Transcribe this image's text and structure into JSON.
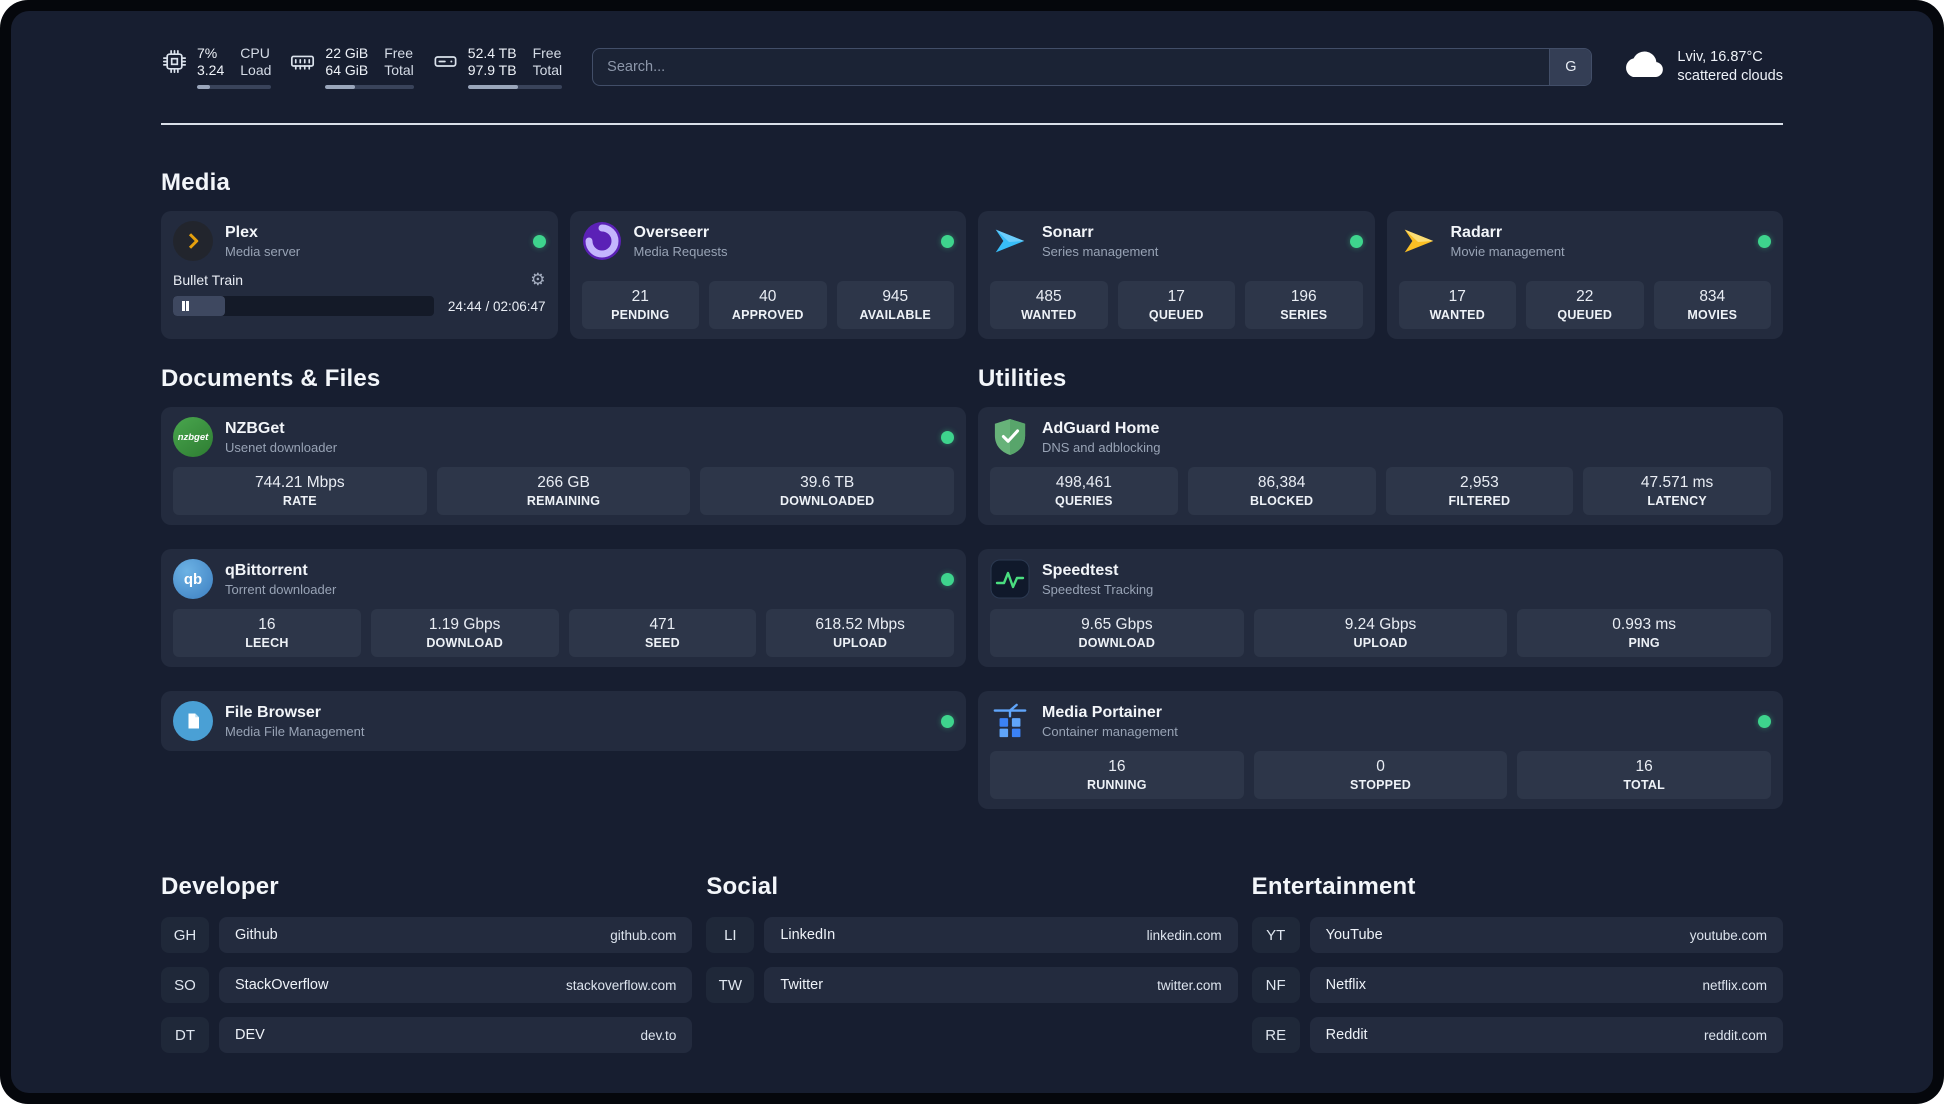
{
  "topbar": {
    "cpu": {
      "value_top": "7%",
      "value_bottom": "3.24",
      "label_top": "CPU",
      "label_bottom": "Load",
      "meter_percent": 18
    },
    "ram": {
      "value_top": "22 GiB",
      "value_bottom": "64 GiB",
      "label_top": "Free",
      "label_bottom": "Total",
      "meter_percent": 33
    },
    "disk": {
      "value_top": "52.4 TB",
      "value_bottom": "97.9 TB",
      "label_top": "Free",
      "label_bottom": "Total",
      "meter_percent": 53
    },
    "search": {
      "placeholder": "Search...",
      "provider_label": "G"
    },
    "weather": {
      "location": "Lviv, 16.87°C",
      "condition": "scattered clouds"
    }
  },
  "media": {
    "title": "Media",
    "plex": {
      "name": "Plex",
      "desc": "Media server",
      "now_playing": "Bullet Train",
      "time": "24:44 / 02:06:47",
      "progress_percent": 20
    },
    "overseerr": {
      "name": "Overseerr",
      "desc": "Media Requests",
      "stats": [
        {
          "value": "21",
          "label": "PENDING"
        },
        {
          "value": "40",
          "label": "APPROVED"
        },
        {
          "value": "945",
          "label": "AVAILABLE"
        }
      ]
    },
    "sonarr": {
      "name": "Sonarr",
      "desc": "Series management",
      "stats": [
        {
          "value": "485",
          "label": "WANTED"
        },
        {
          "value": "17",
          "label": "QUEUED"
        },
        {
          "value": "196",
          "label": "SERIES"
        }
      ]
    },
    "radarr": {
      "name": "Radarr",
      "desc": "Movie management",
      "stats": [
        {
          "value": "17",
          "label": "WANTED"
        },
        {
          "value": "22",
          "label": "QUEUED"
        },
        {
          "value": "834",
          "label": "MOVIES"
        }
      ]
    }
  },
  "documents": {
    "title": "Documents & Files",
    "nzbget": {
      "name": "NZBGet",
      "desc": "Usenet downloader",
      "icon_text": "nzbget",
      "stats": [
        {
          "value": "744.21 Mbps",
          "label": "RATE"
        },
        {
          "value": "266 GB",
          "label": "REMAINING"
        },
        {
          "value": "39.6 TB",
          "label": "DOWNLOADED"
        }
      ]
    },
    "qbittorrent": {
      "name": "qBittorrent",
      "desc": "Torrent downloader",
      "icon_text": "qb",
      "stats": [
        {
          "value": "16",
          "label": "LEECH"
        },
        {
          "value": "1.19 Gbps",
          "label": "DOWNLOAD"
        },
        {
          "value": "471",
          "label": "SEED"
        },
        {
          "value": "618.52 Mbps",
          "label": "UPLOAD"
        }
      ]
    },
    "filebrowser": {
      "name": "File Browser",
      "desc": "Media File Management"
    }
  },
  "utilities": {
    "title": "Utilities",
    "adguard": {
      "name": "AdGuard Home",
      "desc": "DNS and adblocking",
      "stats": [
        {
          "value": "498,461",
          "label": "QUERIES"
        },
        {
          "value": "86,384",
          "label": "BLOCKED"
        },
        {
          "value": "2,953",
          "label": "FILTERED"
        },
        {
          "value": "47.571 ms",
          "label": "LATENCY"
        }
      ]
    },
    "speedtest": {
      "name": "Speedtest",
      "desc": "Speedtest Tracking",
      "stats": [
        {
          "value": "9.65 Gbps",
          "label": "DOWNLOAD"
        },
        {
          "value": "9.24 Gbps",
          "label": "UPLOAD"
        },
        {
          "value": "0.993 ms",
          "label": "PING"
        }
      ]
    },
    "portainer": {
      "name": "Media Portainer",
      "desc": "Container management",
      "stats": [
        {
          "value": "16",
          "label": "RUNNING"
        },
        {
          "value": "0",
          "label": "STOPPED"
        },
        {
          "value": "16",
          "label": "TOTAL"
        }
      ]
    }
  },
  "bookmarks": {
    "developer": {
      "title": "Developer",
      "items": [
        {
          "abbr": "GH",
          "name": "Github",
          "url": "github.com"
        },
        {
          "abbr": "SO",
          "name": "StackOverflow",
          "url": "stackoverflow.com"
        },
        {
          "abbr": "DT",
          "name": "DEV",
          "url": "dev.to"
        }
      ]
    },
    "social": {
      "title": "Social",
      "items": [
        {
          "abbr": "LI",
          "name": "LinkedIn",
          "url": "linkedin.com"
        },
        {
          "abbr": "TW",
          "name": "Twitter",
          "url": "twitter.com"
        }
      ]
    },
    "entertainment": {
      "title": "Entertainment",
      "items": [
        {
          "abbr": "YT",
          "name": "YouTube",
          "url": "youtube.com"
        },
        {
          "abbr": "NF",
          "name": "Netflix",
          "url": "netflix.com"
        },
        {
          "abbr": "RE",
          "name": "Reddit",
          "url": "reddit.com"
        }
      ]
    }
  }
}
